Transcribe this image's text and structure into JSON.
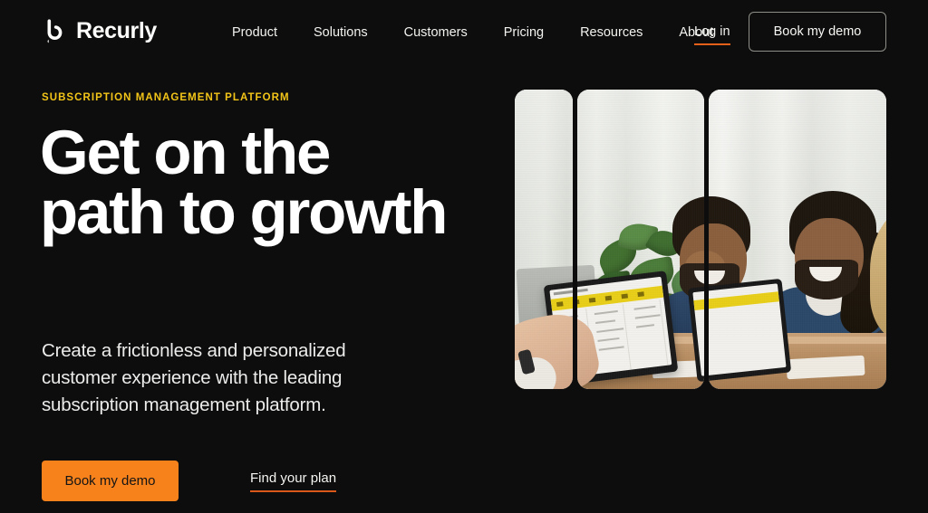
{
  "brand": {
    "name": "Recurly",
    "logo_icon": "recurly-hook-mark",
    "accent_orange": "#f7821b",
    "accent_yellow": "#f3c518",
    "background": "#0d0d0d",
    "text_primary": "#ffffff"
  },
  "header": {
    "nav_items": [
      {
        "label": "Product"
      },
      {
        "label": "Solutions"
      },
      {
        "label": "Customers"
      },
      {
        "label": "Pricing"
      },
      {
        "label": "Resources"
      },
      {
        "label": "About"
      }
    ],
    "login_label": "Log in",
    "demo_button_label": "Book my demo"
  },
  "hero": {
    "eyebrow": "SUBSCRIPTION MANAGEMENT PLATFORM",
    "headline": "Get on the path to growth",
    "subcopy": "Create a frictionless and personalized customer experience with the leading subscription management platform.",
    "primary_cta": "Book my demo",
    "secondary_cta": "Find your plan"
  },
  "media": {
    "panel_count": 3,
    "description": "Three rounded vertical panels showing one continuous office photo of three colleagues laughing at a desk with laptops and a plant",
    "panels": [
      {
        "name": "photo-panel-1"
      },
      {
        "name": "photo-panel-2"
      },
      {
        "name": "photo-panel-3"
      }
    ]
  }
}
